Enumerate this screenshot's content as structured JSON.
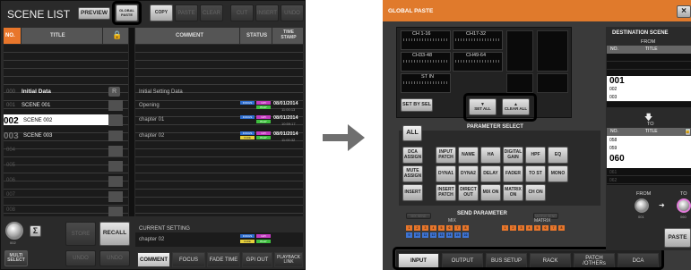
{
  "scene_list": {
    "title": "SCENE LIST",
    "preview": "PREVIEW",
    "global_paste": "GLOBAL PASTE",
    "copy": "COPY",
    "paste": "PASTE",
    "clear": "CLEAR",
    "cut": "CUT",
    "insert": "INSERT",
    "undo": "UNDO",
    "col_no": "NO.",
    "col_title": "TITLE",
    "col_comment": "COMMENT",
    "col_status": "STATUS",
    "col_stamp": "TIME STAMP",
    "rows": [
      {
        "no": "000",
        "title": "Initial Data",
        "comment": "Initial Setting Data",
        "lock": "R",
        "date": "",
        "time": ""
      },
      {
        "no": "001",
        "title": "SCENE 001",
        "comment": "Opening",
        "lock": "",
        "date": "08/01/2014",
        "time": "11:00:13"
      },
      {
        "no": "002",
        "title": "SCENE 002",
        "comment": "chapter 01",
        "lock": "lock",
        "date": "08/01/2014",
        "time": "10:59:17"
      },
      {
        "no": "003",
        "title": "SCENE 003",
        "comment": "chapter 02",
        "lock": "",
        "date": "08/01/2014",
        "time": "11:00:32"
      },
      {
        "no": "004"
      },
      {
        "no": "005"
      },
      {
        "no": "006"
      },
      {
        "no": "007"
      },
      {
        "no": "008"
      }
    ],
    "status_tags": {
      "focus": "FOCUS",
      "gpi": "GPI",
      "fade": "FADE",
      "play": "PLAY"
    },
    "current_setting_label": "CURRENT SETTING",
    "current_comment": "chapter 02",
    "current_scene_no": "002",
    "store": "STORE",
    "recall": "RECALL",
    "multi_select": "MULTI SELECT",
    "redo": "UNDO",
    "bottom_tabs": [
      "COMMENT",
      "FOCUS",
      "FADE TIME",
      "GPI OUT",
      "PLAYBACK LINK"
    ]
  },
  "global_paste": {
    "title": "GLOBAL PASTE",
    "close": "×",
    "channel_groups": [
      "CH 1-16",
      "CH17-32",
      "CH33-48",
      "CH49-64",
      "ST IN"
    ],
    "set_by_sel": "SET BY SEL",
    "set_all": "SET ALL",
    "clear_all": "CLEAR ALL",
    "parameter_select": "PARAMETER SELECT",
    "all": "ALL",
    "params_row1": [
      "DCA ASSIGN",
      "INPUT PATCH",
      "NAME",
      "HA",
      "DIGITAL GAIN",
      "HPF",
      "EQ"
    ],
    "params_row2": [
      "MUTE ASSIGN",
      "DYNA1",
      "DYNA2",
      "DELAY",
      "FADER",
      "TO ST",
      "MONO"
    ],
    "params_row3": [
      "INSERT",
      "INSERT PATCH",
      "DIRECT OUT",
      "MIX ON",
      "MATRIX ON",
      "CH ON"
    ],
    "send_parameter": "SEND PARAMETER",
    "mix_label": "MIX",
    "matrix_label": "MATRIX",
    "mix_send": "MIX SEND",
    "matrix_send": "MATRIX SEND",
    "mix_numbers": [
      "1",
      "2",
      "3",
      "4",
      "5",
      "6",
      "7",
      "8",
      "9",
      "10",
      "11",
      "12",
      "13",
      "14",
      "15",
      "16"
    ],
    "matrix_numbers": [
      "1",
      "2",
      "3",
      "4",
      "5",
      "6",
      "7",
      "8"
    ],
    "destination_scene": "DESTINATION SCENE",
    "from": "FROM",
    "to": "TO",
    "dest_col_no": "NO.",
    "dest_col_title": "TITLE",
    "from_rows": [
      "001",
      "002",
      "003"
    ],
    "to_rows": [
      "058",
      "059",
      "060",
      "061",
      "062"
    ],
    "from_knob_value": "001",
    "to_knob_value": "060",
    "paste_button": "PASTE",
    "tabs": [
      "INPUT",
      "OUTPUT",
      "BUS SETUP",
      "RACK",
      "PATCH /OTHERs",
      "DCA"
    ]
  },
  "colors": {
    "accent": "#e8762b",
    "focus": "#2f6fd1",
    "gpi": "#c43bc0",
    "fade": "#e6d03a",
    "play": "#3fc03f"
  }
}
